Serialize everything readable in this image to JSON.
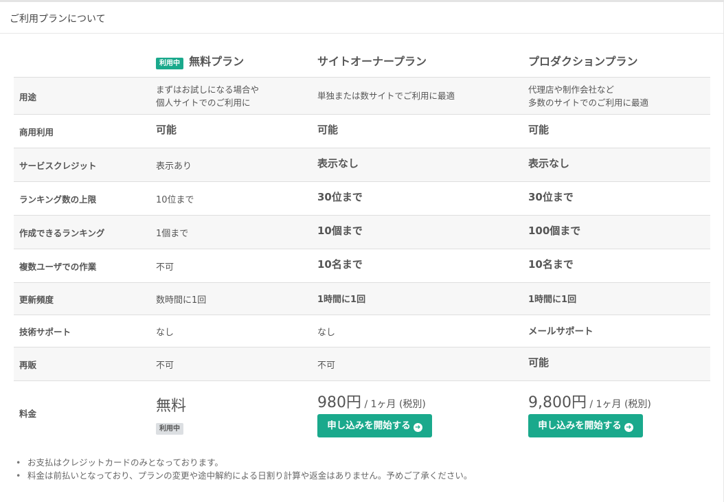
{
  "panel": {
    "title": "ご利用プランについて"
  },
  "plans": {
    "free": {
      "name": "無料プラン",
      "badge": "利用中"
    },
    "owner": {
      "name": "サイトオーナープラン"
    },
    "production": {
      "name": "プロダクションプラン"
    }
  },
  "rows": [
    {
      "label": "用途",
      "free": "まずはお試しになる場合や|個人サイトでのご利用に",
      "owner": "単独または数サイトでご利用に最適",
      "production": "代理店や制作会社など|多数のサイトでのご利用に最適"
    },
    {
      "label": "商用利用",
      "free": "可能",
      "owner": "可能",
      "production": "可能"
    },
    {
      "label": "サービスクレジット",
      "free": "表示あり",
      "owner": "表示なし",
      "production": "表示なし"
    },
    {
      "label": "ランキング数の上限",
      "free": "10位まで",
      "owner": "30位まで",
      "production": "30位まで"
    },
    {
      "label": "作成できるランキング",
      "free": "1個まで",
      "owner": "10個まで",
      "production": "100個まで"
    },
    {
      "label": "複数ユーザでの作業",
      "free": "不可",
      "owner": "10名まで",
      "production": "10名まで"
    },
    {
      "label": "更新頻度",
      "free": "数時間に1回",
      "owner": "1時間に1回",
      "production": "1時間に1回"
    },
    {
      "label": "技術サポート",
      "free": "なし",
      "owner": "なし",
      "production": "メールサポート"
    },
    {
      "label": "再販",
      "free": "不可",
      "owner": "不可",
      "production": "可能"
    },
    {
      "label": "料金"
    }
  ],
  "pricing": {
    "free_price": "無料",
    "free_badge": "利用中",
    "owner_price": "980円",
    "owner_unit": " / 1ヶ月 (税別)",
    "production_price": "9,800円",
    "production_unit": " / 1ヶ月 (税別)",
    "cta_label": "申し込みを開始する",
    "cta_icon": "arrow-circle-right-icon"
  },
  "notes": [
    "お支払はクレジットカードのみとなっております。",
    "料金は前払いとなっており、プランの変更や途中解約による日割り計算や返金はありません。予めご了承ください。"
  ],
  "colors": {
    "accent": "#1aa98c",
    "badge_gray": "#dcdfe2",
    "stripe": "#f7f7f7"
  }
}
